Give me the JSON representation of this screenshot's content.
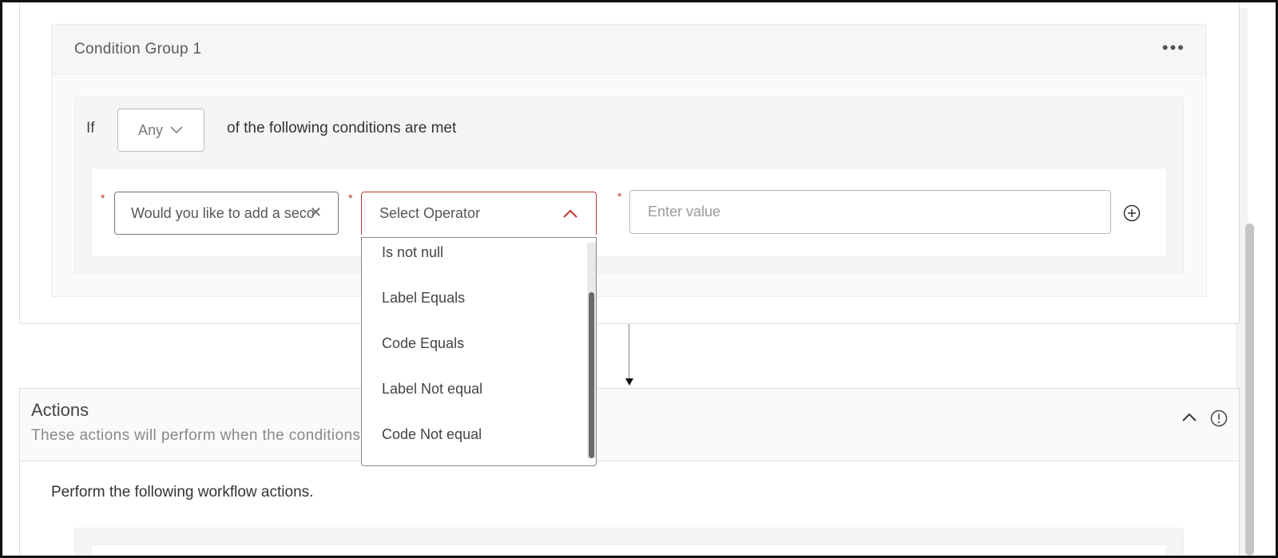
{
  "condition_group": {
    "title": "Condition Group 1",
    "more_icon": "more-horizontal-icon"
  },
  "rule": {
    "if_label": "If",
    "match_select": "Any",
    "conditions_text": "of the following conditions are met"
  },
  "condition_row": {
    "required_mark": "*",
    "question_value": "Would you like to add a seco",
    "operator_placeholder": "Select Operator",
    "value_placeholder": "Enter value"
  },
  "operator_options": [
    "Is not null",
    "Label Equals",
    "Code Equals",
    "Label Not equal",
    "Code Not equal"
  ],
  "actions": {
    "title": "Actions",
    "subtitle": "These actions will perform when the conditions are met",
    "perform_text": "Perform the following workflow actions."
  },
  "colors": {
    "error_red": "#c0392b",
    "border_gray": "#dcdcdc"
  }
}
